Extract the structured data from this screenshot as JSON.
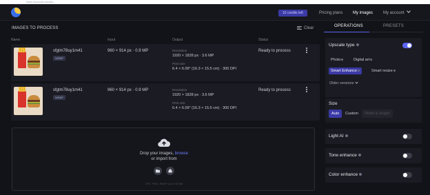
{
  "browser": {
    "url": "https://upscale.media/..."
  },
  "nav": {
    "credits": "10 credits left",
    "pricing": "Pricing plans",
    "images": "My images",
    "account": "My account"
  },
  "panel": {
    "title": "IMAGES TO PROCESS",
    "clear": "Clear",
    "columns": {
      "name": "Name",
      "input": "Input",
      "output": "Output",
      "status": "Status"
    }
  },
  "rows": [
    {
      "name": "sfgtm78uy1m41",
      "format": "WEBP",
      "input": "960 × 914 px · 0.9 MP",
      "resolution_label": "Resolution",
      "resolution": "1920 × 1828 px · 3.6 MP",
      "print_label": "Print size",
      "print": "6.4 × 6.09\" (16.3 × 15.5 cm) · 300 DPI",
      "status": "Ready to process"
    },
    {
      "name": "sfgtm78uy1m41",
      "format": "WEBP",
      "input": "960 × 914 px · 0.9 MP",
      "resolution_label": "Resolution",
      "resolution": "1920 × 1828 px · 3.6 MP",
      "print_label": "Print size",
      "print": "6.4 × 6.09\" (16.3 × 15.5 cm) · 300 DPI",
      "status": "Ready to process"
    }
  ],
  "dropzone": {
    "drop_text": "Drop your images, ",
    "browse": "browse",
    "import_text": "or import from",
    "formats": "JPG, PNG, WebP up to 50 MB"
  },
  "tabs": {
    "operations": "OPERATIONS",
    "presets": "PRESETS"
  },
  "upscale": {
    "title": "Upscale type",
    "enabled": true,
    "options": [
      "Photo",
      "Digital art",
      "Smart Enhance",
      "Smart resize"
    ],
    "selected": "Smart Enhance",
    "older": "Older versions"
  },
  "size": {
    "title": "Size",
    "options": [
      "Auto",
      "Custom",
      "Width & Height"
    ],
    "selected": "Auto"
  },
  "toggles": {
    "light_ai": {
      "label": "Light AI",
      "enabled": false
    },
    "tone": {
      "label": "Tone enhance",
      "enabled": false
    },
    "color": {
      "label": "Color enhance",
      "enabled": false
    }
  },
  "colors": {
    "accent": "#5b66f0",
    "selected_bg": "#3b3aa6",
    "link": "#6d7cff"
  }
}
